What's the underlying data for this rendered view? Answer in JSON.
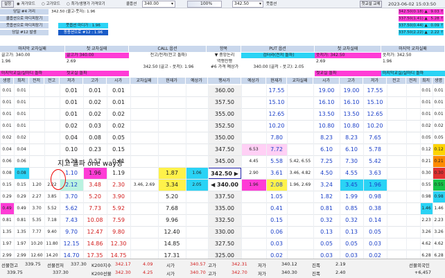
{
  "toolbar": {
    "settings": "설정",
    "radio1": "저가모드",
    "radio2": "고가모드",
    "radio3": "최가/생명가 가격모기",
    "price_label": "콜옵션",
    "price_value": "340.00",
    "zoom_value": "100%",
    "put_value": "342.50",
    "put_label": "풋옵션",
    "first_btn": "첫교설 교체",
    "datetime": "2023-06-02 15:03:50"
  },
  "left_info": [
    {
      "label": "당일 #4 거리",
      "value": "342.50 (콜고-풋저): 1.96"
    },
    {
      "label": "콜옵션으로 마디피장기",
      "value": ""
    },
    {
      "label": "풋옵션으로 마디피장기",
      "value": "풋옵션 마디가 : 1.96"
    },
    {
      "label": "당일 #12 발생",
      "value": "동종션으로 #12 : 1.96"
    }
  ],
  "right_info": [
    {
      "text": "342.50(0.18) ▲",
      "val": "9.03 ↑"
    },
    {
      "text": "337.50(1.41) ▲",
      "val": "5.28 ↑"
    },
    {
      "text": "337.50(0.44) ▲",
      "val": "0.09 ↑"
    },
    {
      "text": "337.50(2.22) ▲",
      "val": "2.22 ↑"
    }
  ],
  "summary_headers": [
    "마지막 교차실패",
    "첫 교차실패",
    "CALL 옵션",
    "항목",
    "PUT 옵션",
    "첫 교차실패",
    "마지막 교차실패"
  ],
  "summary_rows": [
    [
      "콜고가: 340.00",
      "콜고가 340.00",
      "전고/전저(전고 돌파)",
      "▼ 중앙논리",
      "검터라(전저 돌파)",
      "풋저가: 342.50",
      "풋저가: 342.50"
    ],
    [
      "1.96",
      "2.69",
      "",
      "역행진행",
      "",
      "2.69",
      "1.96"
    ],
    [
      "",
      "",
      "342.50 (콜고 - 풋저): 1.96",
      "#6 가격 예상가",
      "340.00 (콜저 - 풋고): 2.05",
      "",
      ""
    ],
    [
      "마지막교실/실마디 돌파",
      "첫교실 돌파",
      "",
      "",
      "",
      "첫교실 돌파",
      "마지막교실/실마디 돌파"
    ]
  ],
  "grid_headers": [
    "생명",
    "최저",
    "전저",
    "전고",
    "저가",
    "고가",
    "시가",
    "교차실패",
    "현재가",
    "예상가",
    "행사가",
    "예상가",
    "현재가",
    "교차실패",
    "시가",
    "고가",
    "저가",
    "전고",
    "전저",
    "최저",
    "생명"
  ],
  "strikes": [
    "360.00",
    "357.50",
    "355.00",
    "352.50",
    "350.00",
    "347.50",
    "345.00",
    "342.50 ▶",
    "◀ 340.00",
    "337.50",
    "335.00",
    "332.50",
    "330.00",
    "327.50",
    "325.00"
  ],
  "call_rows": [
    [
      "0.01",
      "0.01",
      "",
      "",
      "0.01",
      "0.01",
      "0.01",
      "",
      "",
      ""
    ],
    [
      "0.01",
      "0.01",
      "",
      "",
      "0.01",
      "0.02",
      "0.01",
      "",
      "",
      ""
    ],
    [
      "0.01",
      "0.01",
      "",
      "",
      "0.01",
      "0.02",
      "0.02",
      "",
      "",
      ""
    ],
    [
      "0.01",
      "0.01",
      "",
      "",
      "0.02",
      "0.03",
      "0.02",
      "",
      "",
      ""
    ],
    [
      "0.02",
      "0.02",
      "",
      "",
      "0.04",
      "0.08",
      "0.05",
      "",
      "",
      ""
    ],
    [
      "0.04",
      "0.04",
      "",
      "",
      "0.10",
      "0.23",
      "0.15",
      "",
      "",
      ""
    ],
    [
      "0.06",
      "0.06",
      "",
      "",
      "0.23",
      "0.57",
      "0.41",
      "",
      "",
      ""
    ],
    [
      "0.08",
      "0.08",
      "",
      "",
      "1.10",
      "1.96",
      "1.19",
      "",
      "1.87",
      "1.06"
    ],
    [
      "0.15",
      "0.15",
      "1.20",
      "2.22",
      "2.12",
      "3.48",
      "2.30",
      "3.46, 2.69",
      "3.34",
      "2.05"
    ],
    [
      "0.29",
      "0.29",
      "2.27",
      "3.85",
      "3.70",
      "5.20",
      "3.90",
      "",
      "5.20",
      ""
    ],
    [
      "0.49",
      "0.49",
      "3.70",
      "5.52",
      "5.62",
      "7.73",
      "5.92",
      "",
      "7.68",
      ""
    ],
    [
      "0.81",
      "0.81",
      "5.35",
      "7.18",
      "7.43",
      "10.08",
      "7.59",
      "",
      "9.96",
      ""
    ],
    [
      "1.35",
      "1.35",
      "7.77",
      "9.40",
      "9.70",
      "12.47",
      "9.80",
      "",
      "12.40",
      ""
    ],
    [
      "1.97",
      "1.97",
      "10.20",
      "11.80",
      "12.15",
      "14.86",
      "12.30",
      "",
      "14.85",
      ""
    ],
    [
      "2.99",
      "2.99",
      "12.60",
      "14.20",
      "14.70",
      "17.35",
      "14.75",
      "",
      "17.31",
      ""
    ]
  ],
  "put_rows": [
    [
      "",
      "17.55",
      "",
      "19.00",
      "19.00",
      "17.55",
      "",
      "",
      "",
      ""
    ],
    [
      "",
      "15.10",
      "",
      "16.10",
      "16.10",
      "15.10",
      "",
      "",
      "",
      ""
    ],
    [
      "",
      "12.65",
      "",
      "13.50",
      "13.50",
      "12.65",
      "",
      "",
      "",
      ""
    ],
    [
      "",
      "10.20",
      "",
      "10.80",
      "10.80",
      "10.20",
      "",
      "",
      "",
      ""
    ],
    [
      "",
      "7.80",
      "",
      "8.23",
      "8.23",
      "7.65",
      "",
      "",
      "",
      ""
    ],
    [
      "6.53",
      "7.72",
      "",
      "6.10",
      "6.10",
      "5.78",
      "",
      "",
      "",
      ""
    ],
    [
      "4.45",
      "5.58",
      "5.42, 6.55",
      "7.25",
      "7.30",
      "5.42",
      "",
      "",
      "",
      ""
    ],
    [
      "2.90",
      "3.61",
      "3.46, 4.82",
      "4.50",
      "4.55",
      "3.63",
      "",
      "",
      "",
      ""
    ],
    [
      "1.96",
      "2.08",
      "1.96, 2.69",
      "3.24",
      "3.45",
      "1.96",
      "",
      "",
      "",
      ""
    ],
    [
      "",
      "1.05",
      "",
      "1.82",
      "1.99",
      "0.98",
      "",
      "",
      "",
      ""
    ],
    [
      "",
      "0.41",
      "",
      "0.81",
      "0.85",
      "0.38",
      "",
      "",
      "",
      ""
    ],
    [
      "",
      "0.15",
      "",
      "0.32",
      "0.32",
      "0.14",
      "",
      "",
      "",
      ""
    ],
    [
      "",
      "0.06",
      "",
      "0.13",
      "0.13",
      "0.05",
      "",
      "",
      "",
      ""
    ],
    [
      "",
      "0.03",
      "",
      "0.05",
      "0.05",
      "0.03",
      "",
      "",
      "",
      ""
    ],
    [
      "",
      "0.02",
      "",
      "0.03",
      "0.03",
      "0.02",
      "",
      "",
      "",
      ""
    ]
  ],
  "right_mini": [
    [
      "0.01",
      "0.01"
    ],
    [
      "0.01",
      "0.01"
    ],
    [
      "0.01",
      "0.01"
    ],
    [
      "0.02",
      "0.02"
    ],
    [
      "0.05",
      "0.05"
    ],
    [
      "0.12",
      "0.12"
    ],
    [
      "0.21",
      "0.21"
    ],
    [
      "0.30",
      "0.30"
    ],
    [
      "0.55",
      "0.55"
    ],
    [
      "0.98",
      "0.98"
    ],
    [
      "1.46",
      "1.46"
    ],
    [
      "2.23",
      "2.23"
    ],
    [
      "3.26",
      "3.26"
    ],
    [
      "4.62",
      "4.62"
    ],
    [
      "6.28",
      "6.28"
    ]
  ],
  "annotation": "지고 돌파 one way장",
  "bottom": {
    "row1": [
      {
        "label": "선물현고",
        "value": "339.75"
      },
      {
        "label": "선물전저",
        "value": "337.30"
      },
      {
        "label": "K200지수",
        "value": "342.17"
      },
      {
        "label": "",
        "value": "4.09"
      },
      {
        "label": "시가",
        "value": "340.57"
      },
      {
        "label": "고가",
        "value": "342.31"
      },
      {
        "label": "저가",
        "value": "340.12"
      },
      {
        "label": "진폭",
        "value": "2.19"
      },
      {
        "label": "선물외국인",
        "value": ""
      }
    ],
    "row2": [
      {
        "label": "",
        "value": "339.75"
      },
      {
        "label": "",
        "value": "337.30"
      },
      {
        "label": "K200선물",
        "value": "342.30"
      },
      {
        "label": "",
        "value": "4.25"
      },
      {
        "label": "시가",
        "value": "340.70"
      },
      {
        "label": "고가",
        "value": "342.70"
      },
      {
        "label": "저가",
        "value": "340.30"
      },
      {
        "label": "진폭",
        "value": "2.40"
      },
      {
        "label": "",
        "value": "+6,457"
      }
    ]
  },
  "colors": {
    "header_bg": "#c9d7ec",
    "call_red": "#d21c1c",
    "put_blue": "#1a3fc8",
    "highlight_yellow": "#fff24a",
    "magenta": "#ff3cd6",
    "cyan": "#2ad3f5"
  }
}
